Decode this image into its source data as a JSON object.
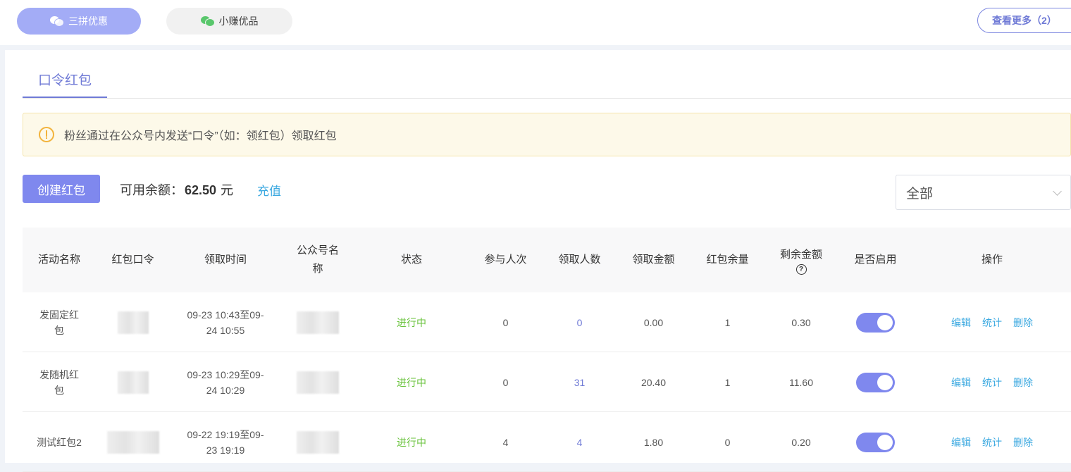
{
  "topbar": {
    "tabs": [
      {
        "label": "三拼优惠",
        "icon": "wechat-icon",
        "active": true
      },
      {
        "label": "小赚优品",
        "icon": "wechat-icon",
        "active": false
      }
    ],
    "more_button": "查看更多（2）"
  },
  "main": {
    "tab_label": "口令红包",
    "notice": "粉丝通过在公众号内发送“口令”（如：领红包）领取红包",
    "create_button": "创建红包",
    "balance_label": "可用余额：",
    "balance_amount": "62.50",
    "balance_unit": "元",
    "recharge_link": "充值",
    "filter_value": "全部"
  },
  "table": {
    "headers": {
      "name": "活动名称",
      "code": "红包口令",
      "time": "领取时间",
      "account": "公众号名称",
      "status": "状态",
      "participants": "参与人次",
      "receivers": "领取人数",
      "amount": "领取金额",
      "remaining_count": "红包余量",
      "remaining_amount": "剩余金额",
      "enabled": "是否启用",
      "actions": "操作"
    },
    "action_labels": {
      "edit": "编辑",
      "stats": "统计",
      "delete": "删除"
    },
    "rows": [
      {
        "name": "发固定红包",
        "time": "09-23 10:43至09-24 10:55",
        "status": "进行中",
        "participants": "0",
        "receivers": "0",
        "amount": "0.00",
        "remaining_count": "1",
        "remaining_amount": "0.30",
        "enabled": true
      },
      {
        "name": "发随机红包",
        "time": "09-23 10:29至09-24 10:29",
        "status": "进行中",
        "participants": "0",
        "receivers": "31",
        "amount": "20.40",
        "remaining_count": "1",
        "remaining_amount": "11.60",
        "enabled": true
      },
      {
        "name": "测试红包2",
        "time": "09-22 19:19至09-23 19:19",
        "status": "进行中",
        "participants": "4",
        "receivers": "4",
        "amount": "1.80",
        "remaining_count": "0",
        "remaining_amount": "0.20",
        "enabled": true
      }
    ]
  },
  "colors": {
    "accent": "#7f88ee",
    "link": "#3aa8e0",
    "status_green": "#67c23a",
    "warning": "#f2b33c"
  }
}
